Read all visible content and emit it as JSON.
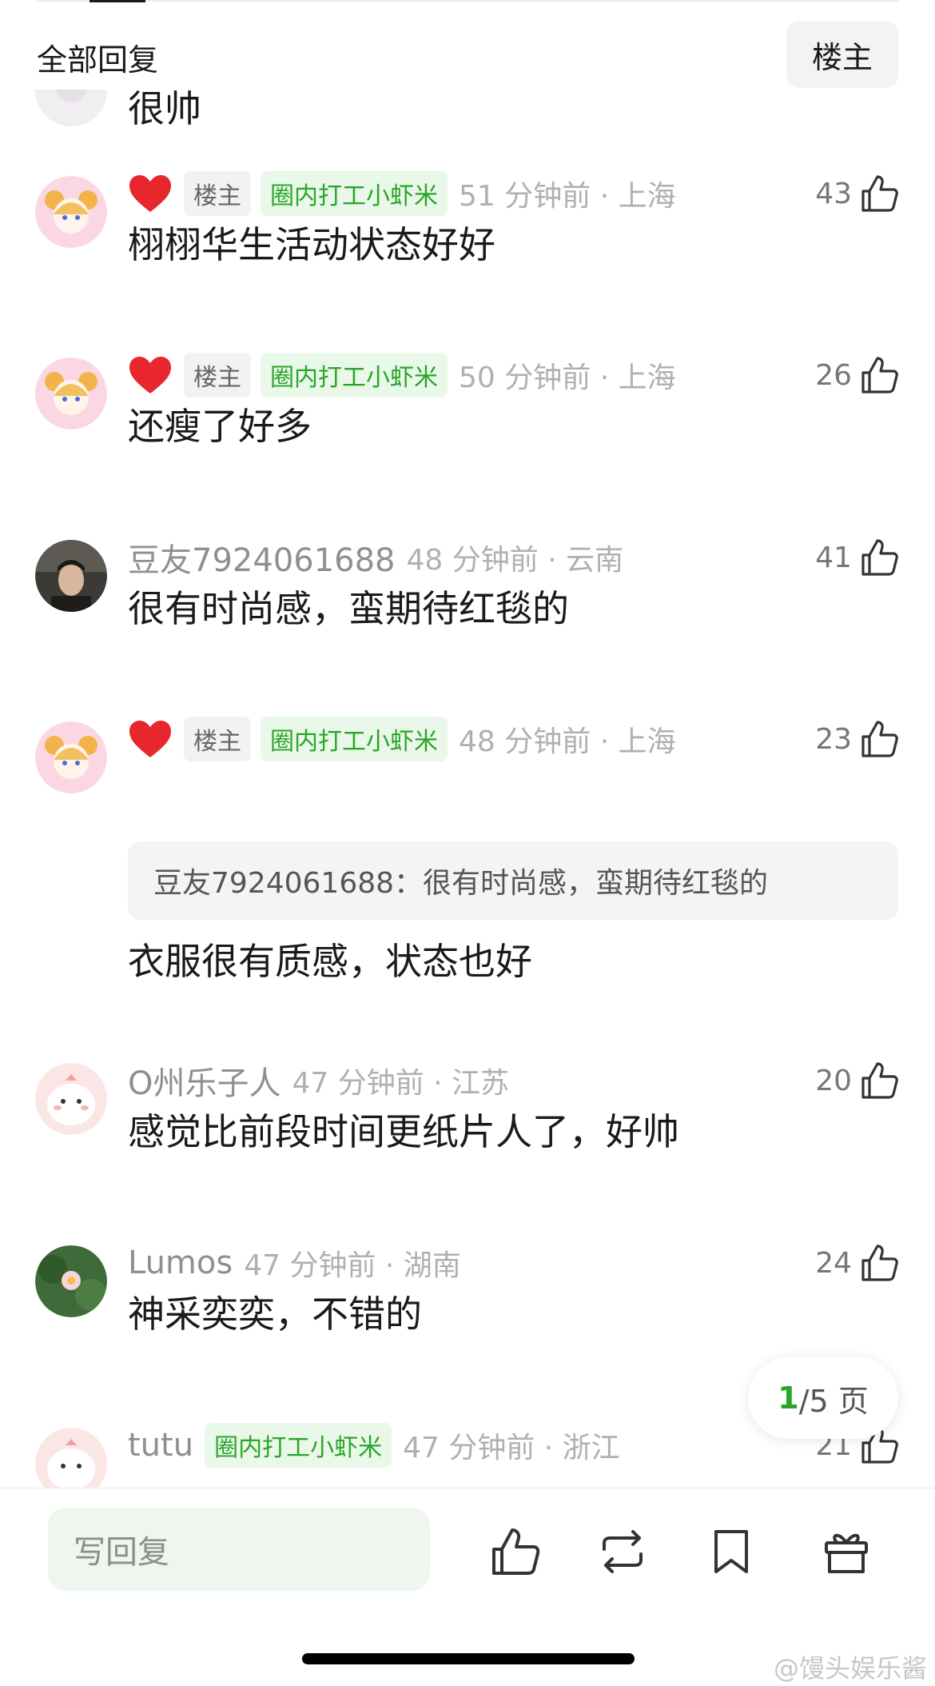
{
  "header": {
    "title": "全部回复",
    "owner_filter": "楼主"
  },
  "partial": {
    "text": "很帅"
  },
  "comments": [
    {
      "heart": true,
      "owner_badge": "楼主",
      "group_badge": "圈内打工小虾米",
      "username": "",
      "timeloc": "51 分钟前 · 上海",
      "likes": "43",
      "quote": "",
      "text": "栩栩华生活动状态好好"
    },
    {
      "heart": true,
      "owner_badge": "楼主",
      "group_badge": "圈内打工小虾米",
      "username": "",
      "timeloc": "50 分钟前 · 上海",
      "likes": "26",
      "quote": "",
      "text": "还瘦了好多"
    },
    {
      "heart": false,
      "owner_badge": "",
      "group_badge": "",
      "username": "豆友7924061688",
      "timeloc": "48 分钟前 · 云南",
      "likes": "41",
      "quote": "",
      "text": "很有时尚感，蛮期待红毯的"
    },
    {
      "heart": true,
      "owner_badge": "楼主",
      "group_badge": "圈内打工小虾米",
      "username": "",
      "timeloc": "48 分钟前 · 上海",
      "likes": "23",
      "quote": "豆友7924061688：很有时尚感，蛮期待红毯的",
      "text": "衣服很有质感，状态也好"
    },
    {
      "heart": false,
      "owner_badge": "",
      "group_badge": "",
      "username": "O州乐子人",
      "timeloc": "47 分钟前 · 江苏",
      "likes": "20",
      "quote": "",
      "text": "感觉比前段时间更纸片人了，好帅"
    },
    {
      "heart": false,
      "owner_badge": "",
      "group_badge": "",
      "username": "Lumos",
      "timeloc": "47 分钟前 · 湖南",
      "likes": "24",
      "quote": "",
      "text": "神采奕奕，不错的"
    },
    {
      "heart": false,
      "owner_badge": "",
      "group_badge": "圈内打工小虾米",
      "username": "tutu",
      "timeloc": "47 分钟前 · 浙江",
      "likes": "21",
      "quote": "",
      "text": ""
    }
  ],
  "pagination": {
    "current": "1",
    "total": "/5 页"
  },
  "bottom": {
    "reply_placeholder": "写回复"
  },
  "watermark": "@馒头娱乐酱",
  "colors": {
    "accent_green": "#2aa52a",
    "heart_red": "#e8262d"
  }
}
